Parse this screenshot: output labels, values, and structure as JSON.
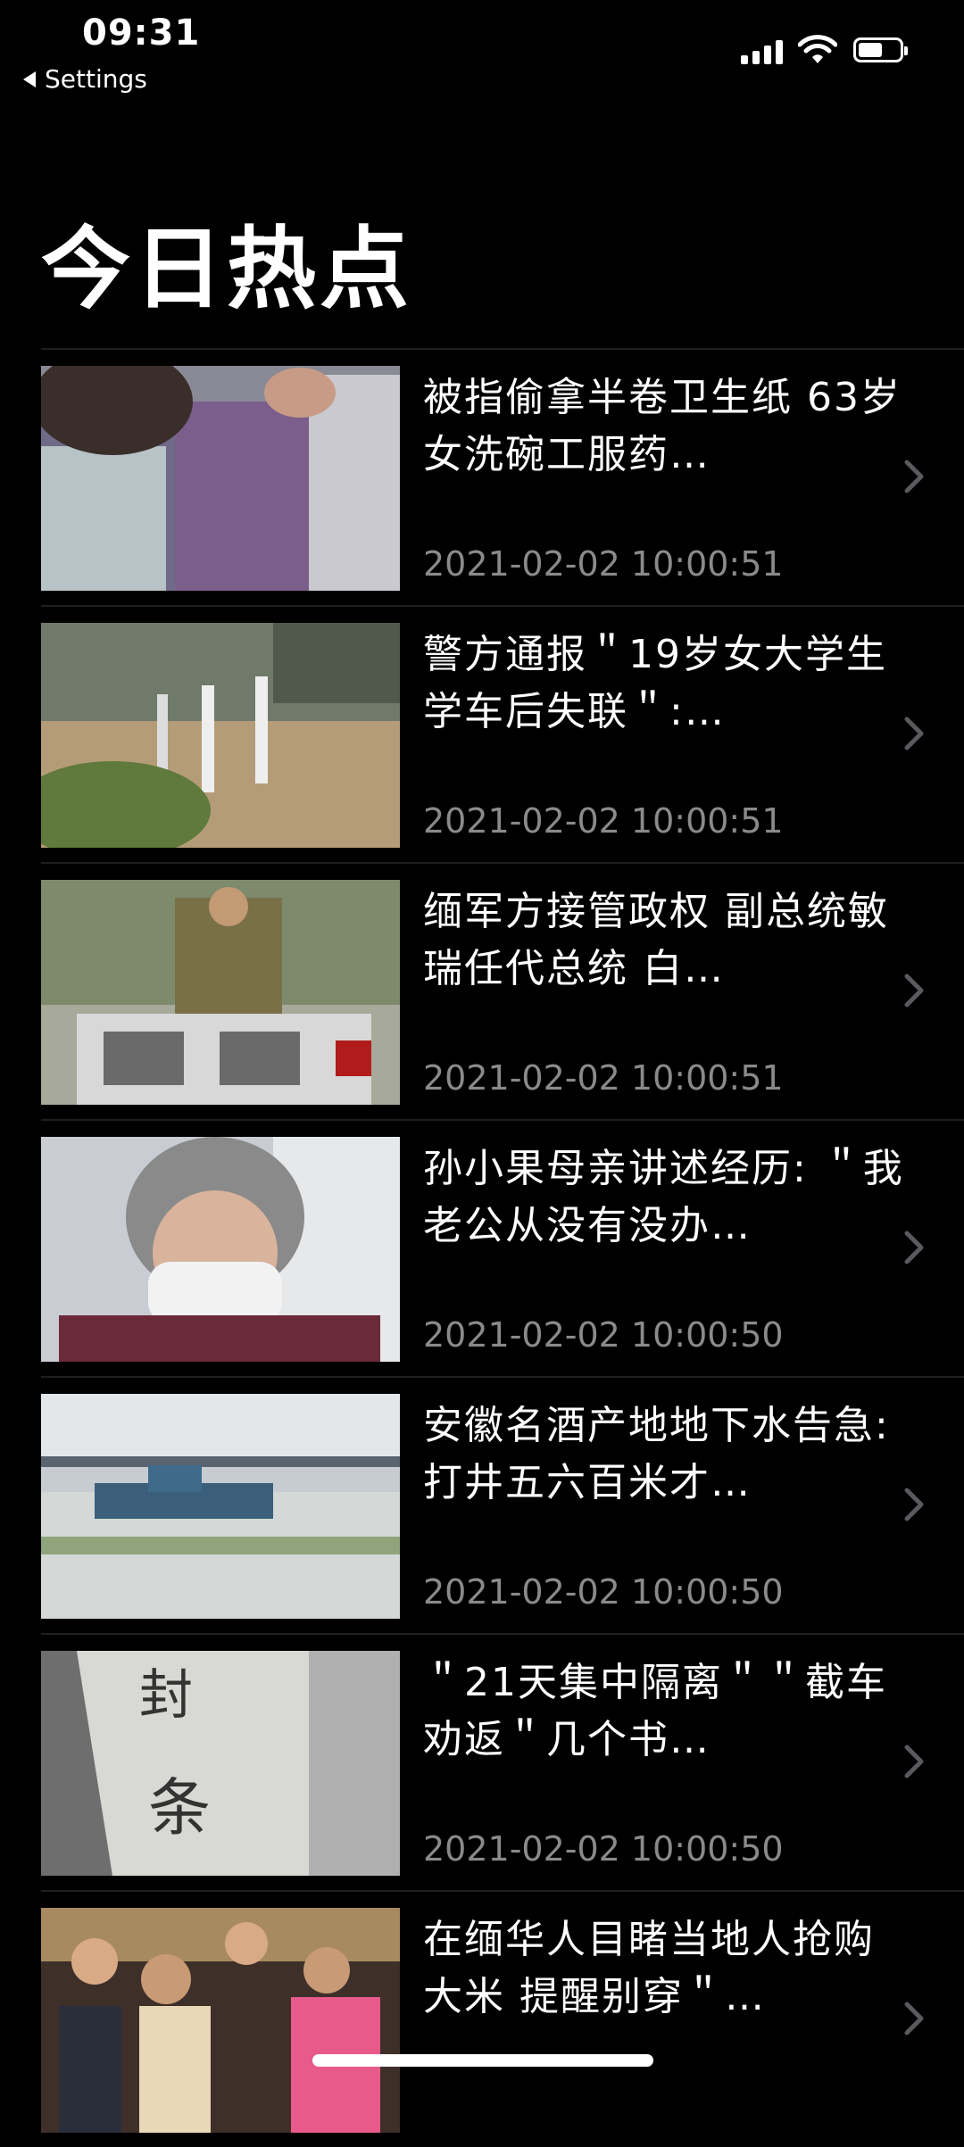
{
  "status": {
    "time": "09:31",
    "back_label": "Settings"
  },
  "page": {
    "title": "今日热点"
  },
  "news": [
    {
      "title": "被指偷拿半卷卫生纸 63岁女洗碗工服药…",
      "time": "2021-02-02 10:00:51"
    },
    {
      "title": "警方通报＂19岁女大学生学车后失联＂:…",
      "time": "2021-02-02 10:00:51"
    },
    {
      "title": "缅军方接管政权 副总统敏瑞任代总统 白…",
      "time": "2021-02-02 10:00:51"
    },
    {
      "title": "孙小果母亲讲述经历: ＂我老公从没有没办…",
      "time": "2021-02-02 10:00:50"
    },
    {
      "title": "安徽名酒产地地下水告急: 打井五六百米才…",
      "time": "2021-02-02 10:00:50"
    },
    {
      "title": "＂21天集中隔离＂＂截车劝返＂几个书…",
      "time": "2021-02-02 10:00:50"
    },
    {
      "title": "在缅华人目睹当地人抢购大米 提醒别穿＂…",
      "time": ""
    }
  ]
}
